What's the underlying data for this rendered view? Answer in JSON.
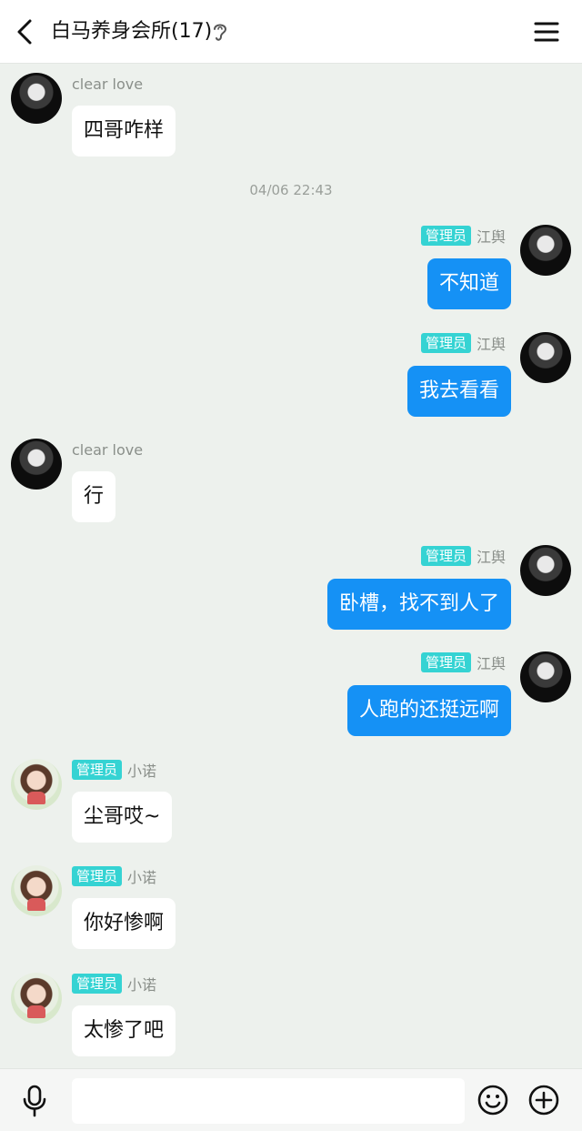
{
  "header": {
    "title": "白马养身会所(17)",
    "back_icon": "chevron-left-icon",
    "ear_icon": "ear-icon",
    "menu_icon": "hamburger-menu-icon"
  },
  "timestamp": "04/06 22:43",
  "messages": [
    {
      "sender": "clear love",
      "badge": "",
      "text": "四哥咋样",
      "side": "left",
      "avatar": "dark"
    },
    {
      "sender": "江舆",
      "badge": "管理员",
      "text": "不知道",
      "side": "right",
      "avatar": "dark"
    },
    {
      "sender": "江舆",
      "badge": "管理员",
      "text": "我去看看",
      "side": "right",
      "avatar": "dark"
    },
    {
      "sender": "clear love",
      "badge": "",
      "text": "行",
      "side": "left",
      "avatar": "dark"
    },
    {
      "sender": "江舆",
      "badge": "管理员",
      "text": "卧槽，找不到人了",
      "side": "right",
      "avatar": "dark"
    },
    {
      "sender": "江舆",
      "badge": "管理员",
      "text": "人跑的还挺远啊",
      "side": "right",
      "avatar": "dark"
    },
    {
      "sender": "小诺",
      "badge": "管理员",
      "text": "尘哥哎~",
      "side": "left",
      "avatar": "girl"
    },
    {
      "sender": "小诺",
      "badge": "管理员",
      "text": "你好惨啊",
      "side": "left",
      "avatar": "girl"
    },
    {
      "sender": "小诺",
      "badge": "管理员",
      "text": "太惨了吧",
      "side": "left",
      "avatar": "girl"
    }
  ],
  "footer": {
    "input_placeholder": "",
    "mic_icon": "microphone-icon",
    "emoji_icon": "emoji-icon",
    "plus_icon": "plus-circle-icon"
  },
  "colors": {
    "background": "#edf1ed",
    "outgoing_bubble": "#1591f5",
    "incoming_bubble": "#ffffff",
    "badge": "#35d3d3"
  }
}
